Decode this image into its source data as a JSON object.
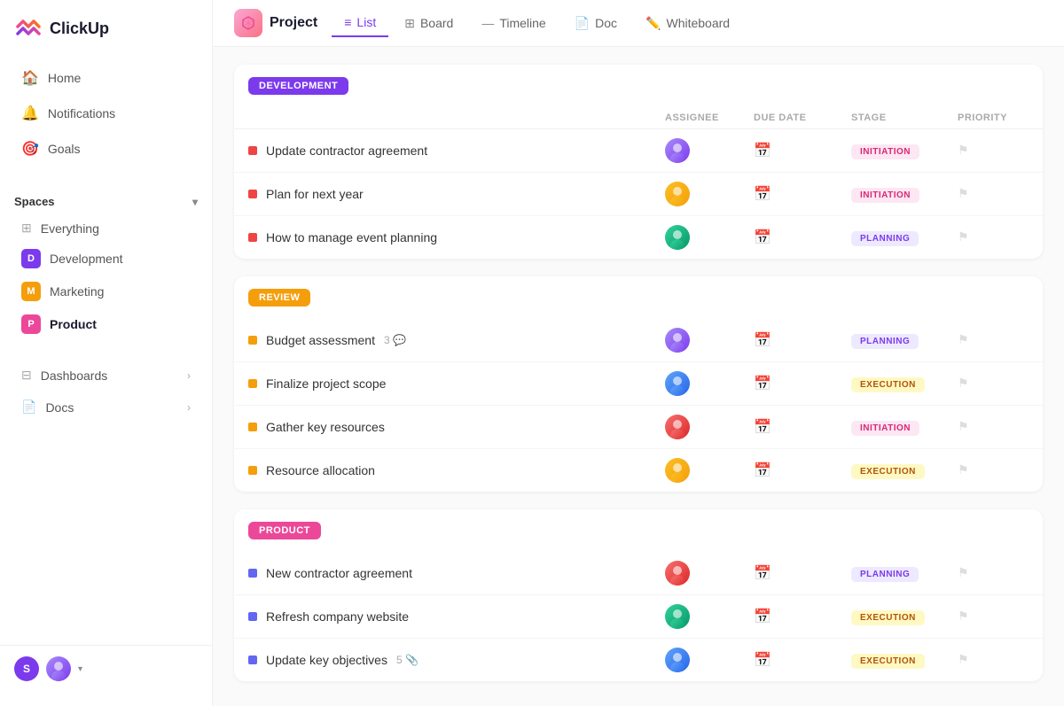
{
  "logo": {
    "text": "ClickUp"
  },
  "sidebar": {
    "nav": [
      {
        "id": "home",
        "label": "Home",
        "icon": "🏠"
      },
      {
        "id": "notifications",
        "label": "Notifications",
        "icon": "🔔"
      },
      {
        "id": "goals",
        "label": "Goals",
        "icon": "🎯"
      }
    ],
    "spaces_label": "Spaces",
    "everything_label": "Everything",
    "spaces": [
      {
        "id": "development",
        "label": "Development",
        "initial": "D",
        "color": "#7c3aed"
      },
      {
        "id": "marketing",
        "label": "Marketing",
        "initial": "M",
        "color": "#f59e0b"
      },
      {
        "id": "product",
        "label": "Product",
        "initial": "P",
        "color": "#ec4899",
        "active": true
      }
    ],
    "expandables": [
      {
        "id": "dashboards",
        "label": "Dashboards"
      },
      {
        "id": "docs",
        "label": "Docs"
      }
    ]
  },
  "topnav": {
    "project_label": "Project",
    "tabs": [
      {
        "id": "list",
        "label": "List",
        "icon": "≡",
        "active": true
      },
      {
        "id": "board",
        "label": "Board",
        "icon": "⊞"
      },
      {
        "id": "timeline",
        "label": "Timeline",
        "icon": "—"
      },
      {
        "id": "doc",
        "label": "Doc",
        "icon": "📄"
      },
      {
        "id": "whiteboard",
        "label": "Whiteboard",
        "icon": "✏️"
      }
    ]
  },
  "table": {
    "headers": {
      "assignee": "ASSIGNEE",
      "due_date": "DUE DATE",
      "stage": "STAGE",
      "priority": "PRIORITY"
    }
  },
  "groups": [
    {
      "id": "development",
      "badge_label": "DEVELOPMENT",
      "badge_class": "badge-dev",
      "tasks": [
        {
          "name": "Update contractor agreement",
          "dot_class": "dot-red",
          "avatar_style": "portrait-1",
          "stage": "INITIATION",
          "stage_class": "stage-initiation"
        },
        {
          "name": "Plan for next year",
          "dot_class": "dot-red",
          "avatar_style": "portrait-2",
          "stage": "INITIATION",
          "stage_class": "stage-initiation"
        },
        {
          "name": "How to manage event planning",
          "dot_class": "dot-red",
          "avatar_style": "portrait-3",
          "stage": "PLANNING",
          "stage_class": "stage-planning"
        }
      ]
    },
    {
      "id": "review",
      "badge_label": "REVIEW",
      "badge_class": "badge-review",
      "tasks": [
        {
          "name": "Budget assessment",
          "dot_class": "dot-yellow",
          "avatar_style": "portrait-1",
          "stage": "PLANNING",
          "stage_class": "stage-planning",
          "extra": "3 💬"
        },
        {
          "name": "Finalize project scope",
          "dot_class": "dot-yellow",
          "avatar_style": "portrait-4",
          "stage": "EXECUTION",
          "stage_class": "stage-execution"
        },
        {
          "name": "Gather key resources",
          "dot_class": "dot-yellow",
          "avatar_style": "portrait-5",
          "stage": "INITIATION",
          "stage_class": "stage-initiation"
        },
        {
          "name": "Resource allocation",
          "dot_class": "dot-yellow",
          "avatar_style": "portrait-2",
          "stage": "EXECUTION",
          "stage_class": "stage-execution"
        }
      ]
    },
    {
      "id": "product",
      "badge_label": "PRODUCT",
      "badge_class": "badge-product",
      "tasks": [
        {
          "name": "New contractor agreement",
          "dot_class": "dot-blue",
          "avatar_style": "portrait-5",
          "stage": "PLANNING",
          "stage_class": "stage-planning"
        },
        {
          "name": "Refresh company website",
          "dot_class": "dot-blue",
          "avatar_style": "portrait-3",
          "stage": "EXECUTION",
          "stage_class": "stage-execution"
        },
        {
          "name": "Update key objectives",
          "dot_class": "dot-blue",
          "avatar_style": "portrait-4",
          "stage": "EXECUTION",
          "stage_class": "stage-execution",
          "extra": "5 📎"
        }
      ]
    }
  ],
  "bottom_user": {
    "initial": "S",
    "color": "#7c3aed"
  }
}
